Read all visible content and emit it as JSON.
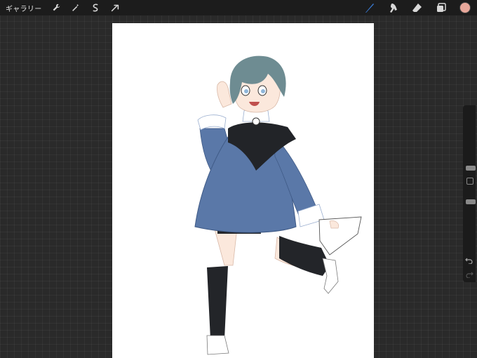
{
  "topbar": {
    "gallery_label": "ギャラリー",
    "left_tools": [
      "wrench-icon",
      "magic-wand-icon",
      "selection-icon",
      "transform-arrow-icon"
    ],
    "right_tools": [
      "brush-icon",
      "smudge-icon",
      "eraser-icon",
      "layers-icon"
    ],
    "active_tool": "brush-icon",
    "active_tool_color": "#3a7bd5",
    "current_color": "#e7a79a"
  },
  "sidebar": {
    "brush_size": 0.25,
    "brush_opacity": 0.5
  },
  "colors": {
    "dress": "#5a78a8",
    "collar": "#222428",
    "hair": "#6e8c92",
    "skin": "#fbe8dc",
    "socks": "#232529"
  }
}
